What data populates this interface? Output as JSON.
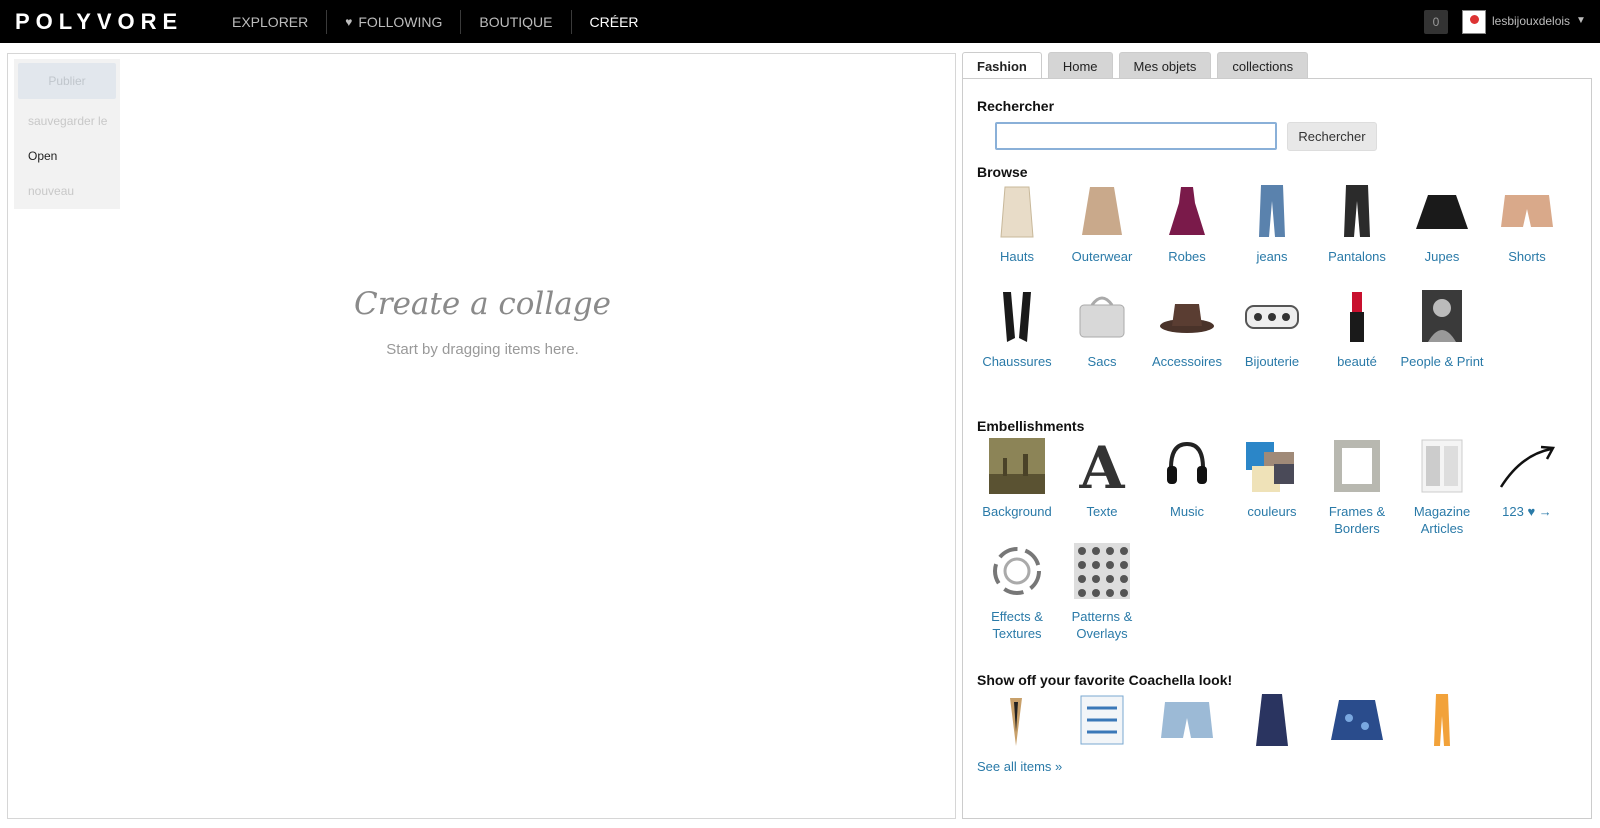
{
  "topbar": {
    "logo": "POLYVORE",
    "nav": [
      "EXPLORER",
      "FOLLOWING",
      "BOUTIQUE",
      "CRÉER"
    ],
    "notifications": "0",
    "username": "lesbijouxdelois"
  },
  "canvas": {
    "publish": "Publier",
    "save": "sauvegarder le",
    "open": "Open",
    "new": "nouveau",
    "title": "Create a collage",
    "subtitle": "Start by dragging items here."
  },
  "tabs": [
    "Fashion",
    "Home",
    "Mes objets",
    "collections"
  ],
  "search": {
    "title": "Rechercher",
    "value": "",
    "button": "Rechercher"
  },
  "browse": {
    "title": "Browse",
    "items": [
      "Hauts",
      "Outerwear",
      "Robes",
      "jeans",
      "Pantalons",
      "Jupes",
      "Shorts",
      "Chaussures",
      "Sacs",
      "Accessoires",
      "Bijouterie",
      "beauté",
      "People & Print"
    ]
  },
  "embellishments": {
    "title": "Embellishments",
    "items": [
      "Background",
      "Texte",
      "Music",
      "couleurs",
      "Frames & Borders",
      "Magazine Articles",
      "123 ♥ →",
      "Effects & Textures",
      "Patterns & Overlays"
    ]
  },
  "coachella": {
    "title": "Show off your favorite Coachella look!",
    "see_all": "See all items »"
  }
}
